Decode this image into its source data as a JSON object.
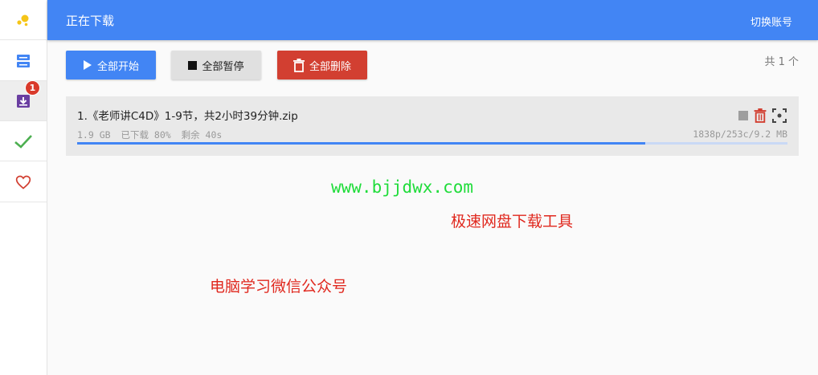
{
  "header": {
    "title": "正在下载",
    "switch_account": "切换账号"
  },
  "sidebar": {
    "badge_count": "1",
    "items": [
      {
        "icon": "logo-dots-icon"
      },
      {
        "icon": "server-stack-icon"
      },
      {
        "icon": "download-tray-icon"
      },
      {
        "icon": "check-icon"
      },
      {
        "icon": "heart-icon"
      }
    ]
  },
  "toolbar": {
    "start_all": "全部开始",
    "pause_all": "全部暂停",
    "delete_all": "全部删除",
    "total": "共 1 个"
  },
  "downloads": [
    {
      "name": "1.《老师讲C4D》1-9节，共2小时39分钟.zip",
      "size": "1.9 GB",
      "downloaded": "已下载 80%",
      "remaining": "剩余 40s",
      "speed_info": "1838p/253c/9.2 MB",
      "progress": 0.8
    }
  ],
  "watermarks": {
    "site": "www.bjjdwx.com",
    "slogan": "极速网盘下载工具",
    "wechat": "电脑学习微信公众号"
  },
  "colors": {
    "primary": "#4285f4",
    "danger": "#d23f31",
    "success": "#4caf50",
    "accent_yellow": "#f5c518"
  }
}
